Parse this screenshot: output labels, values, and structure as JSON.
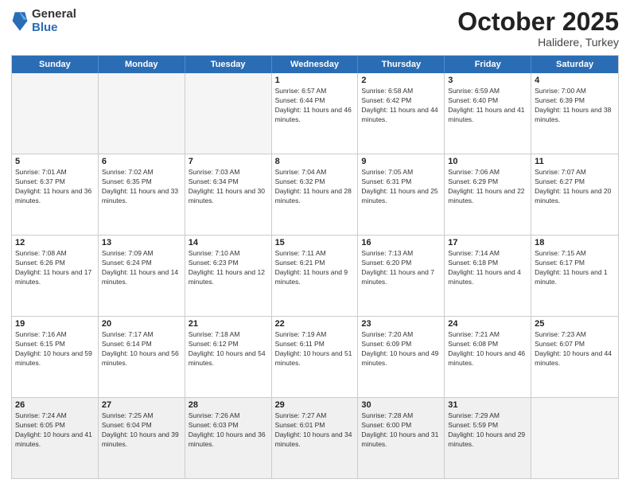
{
  "header": {
    "logo": {
      "general": "General",
      "blue": "Blue"
    },
    "month": "October 2025",
    "location": "Halidere, Turkey"
  },
  "weekdays": [
    "Sunday",
    "Monday",
    "Tuesday",
    "Wednesday",
    "Thursday",
    "Friday",
    "Saturday"
  ],
  "rows": [
    [
      {
        "day": "",
        "empty": true
      },
      {
        "day": "",
        "empty": true
      },
      {
        "day": "",
        "empty": true
      },
      {
        "day": "1",
        "sunrise": "6:57 AM",
        "sunset": "6:44 PM",
        "daylight": "11 hours and 46 minutes."
      },
      {
        "day": "2",
        "sunrise": "6:58 AM",
        "sunset": "6:42 PM",
        "daylight": "11 hours and 44 minutes."
      },
      {
        "day": "3",
        "sunrise": "6:59 AM",
        "sunset": "6:40 PM",
        "daylight": "11 hours and 41 minutes."
      },
      {
        "day": "4",
        "sunrise": "7:00 AM",
        "sunset": "6:39 PM",
        "daylight": "11 hours and 38 minutes."
      }
    ],
    [
      {
        "day": "5",
        "sunrise": "7:01 AM",
        "sunset": "6:37 PM",
        "daylight": "11 hours and 36 minutes."
      },
      {
        "day": "6",
        "sunrise": "7:02 AM",
        "sunset": "6:35 PM",
        "daylight": "11 hours and 33 minutes."
      },
      {
        "day": "7",
        "sunrise": "7:03 AM",
        "sunset": "6:34 PM",
        "daylight": "11 hours and 30 minutes."
      },
      {
        "day": "8",
        "sunrise": "7:04 AM",
        "sunset": "6:32 PM",
        "daylight": "11 hours and 28 minutes."
      },
      {
        "day": "9",
        "sunrise": "7:05 AM",
        "sunset": "6:31 PM",
        "daylight": "11 hours and 25 minutes."
      },
      {
        "day": "10",
        "sunrise": "7:06 AM",
        "sunset": "6:29 PM",
        "daylight": "11 hours and 22 minutes."
      },
      {
        "day": "11",
        "sunrise": "7:07 AM",
        "sunset": "6:27 PM",
        "daylight": "11 hours and 20 minutes."
      }
    ],
    [
      {
        "day": "12",
        "sunrise": "7:08 AM",
        "sunset": "6:26 PM",
        "daylight": "11 hours and 17 minutes."
      },
      {
        "day": "13",
        "sunrise": "7:09 AM",
        "sunset": "6:24 PM",
        "daylight": "11 hours and 14 minutes."
      },
      {
        "day": "14",
        "sunrise": "7:10 AM",
        "sunset": "6:23 PM",
        "daylight": "11 hours and 12 minutes."
      },
      {
        "day": "15",
        "sunrise": "7:11 AM",
        "sunset": "6:21 PM",
        "daylight": "11 hours and 9 minutes."
      },
      {
        "day": "16",
        "sunrise": "7:13 AM",
        "sunset": "6:20 PM",
        "daylight": "11 hours and 7 minutes."
      },
      {
        "day": "17",
        "sunrise": "7:14 AM",
        "sunset": "6:18 PM",
        "daylight": "11 hours and 4 minutes."
      },
      {
        "day": "18",
        "sunrise": "7:15 AM",
        "sunset": "6:17 PM",
        "daylight": "11 hours and 1 minute."
      }
    ],
    [
      {
        "day": "19",
        "sunrise": "7:16 AM",
        "sunset": "6:15 PM",
        "daylight": "10 hours and 59 minutes."
      },
      {
        "day": "20",
        "sunrise": "7:17 AM",
        "sunset": "6:14 PM",
        "daylight": "10 hours and 56 minutes."
      },
      {
        "day": "21",
        "sunrise": "7:18 AM",
        "sunset": "6:12 PM",
        "daylight": "10 hours and 54 minutes."
      },
      {
        "day": "22",
        "sunrise": "7:19 AM",
        "sunset": "6:11 PM",
        "daylight": "10 hours and 51 minutes."
      },
      {
        "day": "23",
        "sunrise": "7:20 AM",
        "sunset": "6:09 PM",
        "daylight": "10 hours and 49 minutes."
      },
      {
        "day": "24",
        "sunrise": "7:21 AM",
        "sunset": "6:08 PM",
        "daylight": "10 hours and 46 minutes."
      },
      {
        "day": "25",
        "sunrise": "7:23 AM",
        "sunset": "6:07 PM",
        "daylight": "10 hours and 44 minutes."
      }
    ],
    [
      {
        "day": "26",
        "sunrise": "7:24 AM",
        "sunset": "6:05 PM",
        "daylight": "10 hours and 41 minutes."
      },
      {
        "day": "27",
        "sunrise": "7:25 AM",
        "sunset": "6:04 PM",
        "daylight": "10 hours and 39 minutes."
      },
      {
        "day": "28",
        "sunrise": "7:26 AM",
        "sunset": "6:03 PM",
        "daylight": "10 hours and 36 minutes."
      },
      {
        "day": "29",
        "sunrise": "7:27 AM",
        "sunset": "6:01 PM",
        "daylight": "10 hours and 34 minutes."
      },
      {
        "day": "30",
        "sunrise": "7:28 AM",
        "sunset": "6:00 PM",
        "daylight": "10 hours and 31 minutes."
      },
      {
        "day": "31",
        "sunrise": "7:29 AM",
        "sunset": "5:59 PM",
        "daylight": "10 hours and 29 minutes."
      },
      {
        "day": "",
        "empty": true
      }
    ]
  ],
  "labels": {
    "sunrise": "Sunrise:",
    "sunset": "Sunset:",
    "daylight": "Daylight:"
  }
}
